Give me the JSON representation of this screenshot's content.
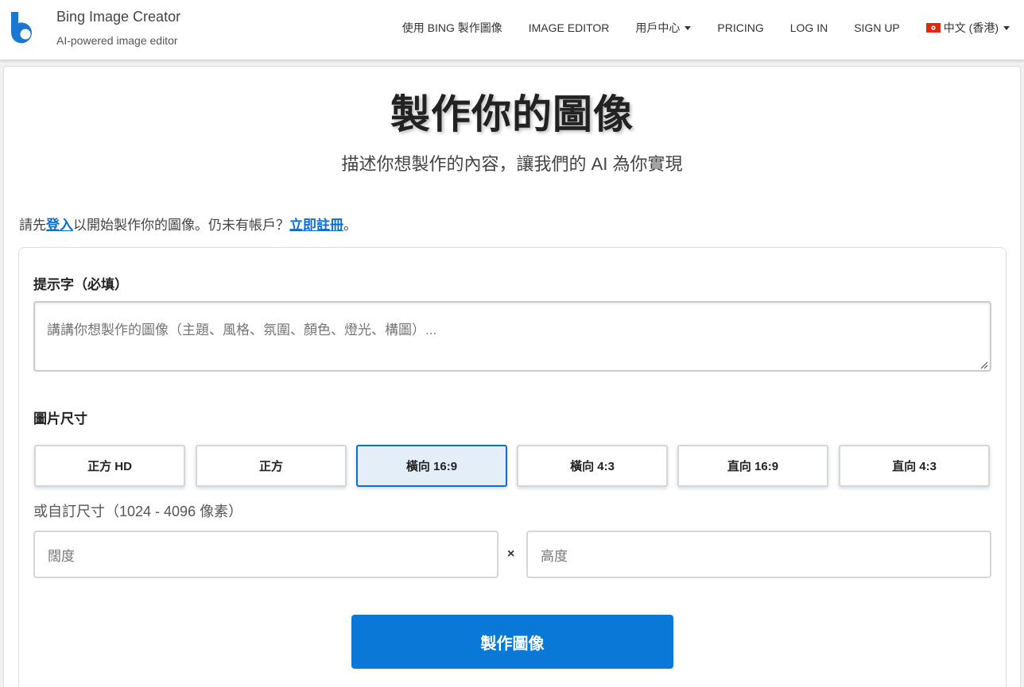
{
  "header": {
    "brand_title": "Bing Image Creator",
    "brand_subtitle": "AI-powered image editor",
    "logo_color": "#1a78d2",
    "nav": [
      {
        "label": "使用 BING 製作圖像"
      },
      {
        "label": "IMAGE EDITOR"
      },
      {
        "label": "用戶中心",
        "dropdown": true
      },
      {
        "label": "PRICING"
      },
      {
        "label": "LOG IN"
      },
      {
        "label": "SIGN UP"
      },
      {
        "label": "中文 (香港)",
        "dropdown": true,
        "icon": "hk-flag-icon"
      }
    ]
  },
  "main": {
    "title": "製作你的圖像",
    "subtitle": "描述你想製作的內容，讓我們的 AI 為你實現",
    "login_prompt": {
      "prefix": "請先",
      "login_link": "登入",
      "middle": "以開始製作你的圖像。仍未有帳戶？",
      "signup_link": "立即註冊",
      "suffix": "。"
    },
    "prompt_label": "提示字（必填）",
    "prompt_placeholder": "講講你想製作的圖像（主題、風格、氛圍、顏色、燈光、構圖）...",
    "size_label": "圖片尺寸",
    "size_options": [
      {
        "label": "正方 HD",
        "selected": false
      },
      {
        "label": "正方",
        "selected": false
      },
      {
        "label": "橫向 16:9",
        "selected": true
      },
      {
        "label": "橫向 4:3",
        "selected": false
      },
      {
        "label": "直向 16:9",
        "selected": false
      },
      {
        "label": "直向 4:3",
        "selected": false
      }
    ],
    "custom_size_label": "或自訂尺寸（1024 - 4096 像素）",
    "width_placeholder": "闊度",
    "times_symbol": "×",
    "height_placeholder": "高度",
    "create_button": "製作圖像",
    "accent_color": "#0a78d6"
  }
}
